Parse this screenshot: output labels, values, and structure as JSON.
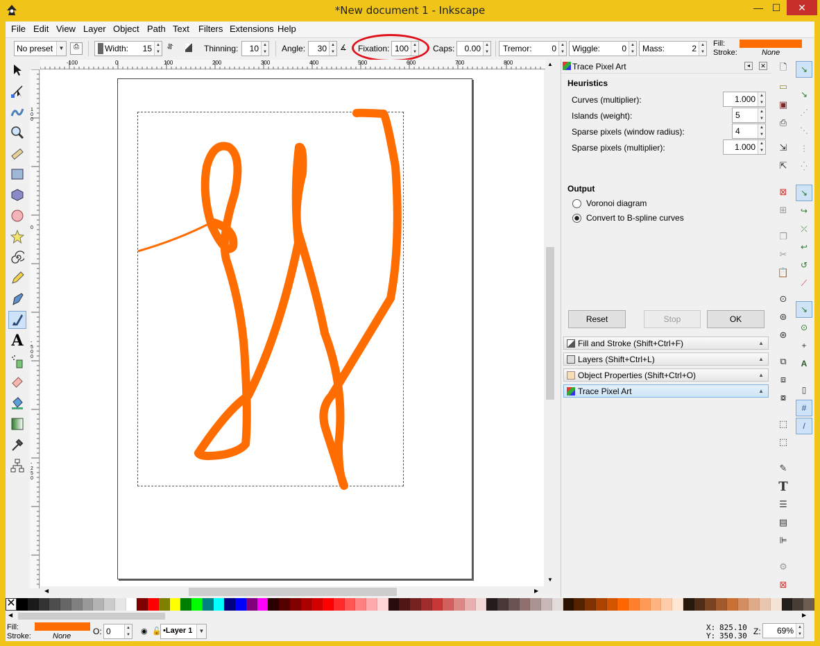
{
  "window": {
    "title": "*New document 1 - Inkscape",
    "minimize": "—",
    "maximize": "☐",
    "close": "✕"
  },
  "menu": [
    "File",
    "Edit",
    "View",
    "Layer",
    "Object",
    "Path",
    "Text",
    "Filters",
    "Extensions",
    "Help"
  ],
  "toolbar": {
    "preset": "No preset",
    "width_label": "Width:",
    "width_value": "15",
    "thinning_label": "Thinning:",
    "thinning_value": "10",
    "angle_label": "Angle:",
    "angle_value": "30",
    "fixation_label": "Fixation:",
    "fixation_value": "100",
    "caps_label": "Caps:",
    "caps_value": "0.00",
    "tremor_label": "Tremor:",
    "tremor_value": "0",
    "wiggle_label": "Wiggle:",
    "wiggle_value": "0",
    "mass_label": "Mass:",
    "mass_value": "2",
    "fill_label": "Fill:",
    "stroke_label": "Stroke:",
    "stroke_value": "None",
    "fill_color": "#ff6c00",
    "highlight_color": "#e0101a"
  },
  "rulers": {
    "h_ticks": [
      "-100",
      "0",
      "100",
      "200",
      "300",
      "400",
      "500",
      "600",
      "700",
      "800"
    ],
    "v_ticks": [
      "100",
      "0",
      "-500",
      "-250"
    ]
  },
  "drawing": {
    "stroke_color": "#ff6c00"
  },
  "dialog": {
    "title": "Trace Pixel Art",
    "heuristics_heading": "Heuristics",
    "curves_label": "Curves (multiplier):",
    "curves_value": "1.000",
    "islands_label": "Islands (weight):",
    "islands_value": "5",
    "sparse_radius_label": "Sparse pixels (window radius):",
    "sparse_radius_value": "4",
    "sparse_mult_label": "Sparse pixels (multiplier):",
    "sparse_mult_value": "1.000",
    "output_heading": "Output",
    "voronoi_label": "Voronoi diagram",
    "bspline_label": "Convert to B-spline curves",
    "reset": "Reset",
    "stop": "Stop",
    "ok": "OK"
  },
  "dock_panels": [
    "Fill and Stroke (Shift+Ctrl+F)",
    "Layers (Shift+Ctrl+L)",
    "Object Properties (Shift+Ctrl+O)",
    "Trace Pixel Art"
  ],
  "palette_colors": [
    "#000000",
    "#1a1a1a",
    "#333333",
    "#4d4d4d",
    "#666666",
    "#808080",
    "#999999",
    "#b3b3b3",
    "#cccccc",
    "#e6e6e6",
    "#ffffff",
    "#800000",
    "#ff0000",
    "#808000",
    "#ffff00",
    "#008000",
    "#00ff00",
    "#008080",
    "#00ffff",
    "#000080",
    "#0000ff",
    "#800080",
    "#ff00ff",
    "#2b0000",
    "#550000",
    "#800000",
    "#aa0000",
    "#d40000",
    "#ff0000",
    "#ff2a2a",
    "#ff5555",
    "#ff8080",
    "#ffaaaa",
    "#ffd5d5",
    "#280b0b",
    "#501616",
    "#782121",
    "#a02c2c",
    "#c83737",
    "#d35f5f",
    "#de8787",
    "#e9afaf",
    "#f4d7d7",
    "#241c1c",
    "#483737",
    "#6c5353",
    "#916f6f",
    "#ac9393",
    "#c8b7b7",
    "#e3dbdb",
    "#2b1100",
    "#552200",
    "#803300",
    "#aa4400",
    "#d45500",
    "#ff6600",
    "#ff7f2a",
    "#ff9955",
    "#ffb380",
    "#ffccaa",
    "#ffe6d5",
    "#28170b",
    "#502d16",
    "#784421",
    "#a05a2c",
    "#c87137",
    "#d38d5f",
    "#deaa87",
    "#e9c6af",
    "#f4e3d7",
    "#241f1c",
    "#483e37",
    "#6c5d53"
  ],
  "status": {
    "fill_label": "Fill:",
    "stroke_label": "Stroke:",
    "stroke_value": "None",
    "opacity_label": "O:",
    "opacity_value": "0",
    "layer": "•Layer 1",
    "x_label": "X:",
    "x_value": "825.10",
    "y_label": "Y:",
    "y_value": "350.30",
    "zoom_label": "Z:",
    "zoom_value": "69%"
  }
}
